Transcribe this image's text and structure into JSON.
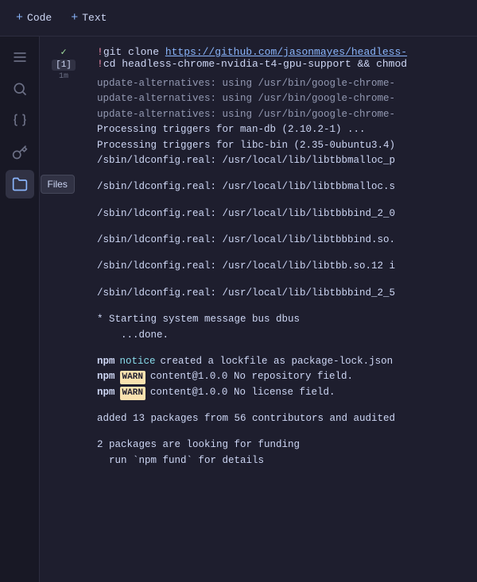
{
  "toolbar": {
    "code_btn_label": "Code",
    "text_btn_label": "Text",
    "plus_symbol": "+"
  },
  "sidebar": {
    "items": [
      {
        "id": "menu",
        "label": "Menu",
        "icon": "menu"
      },
      {
        "id": "search",
        "label": "Search",
        "icon": "search"
      },
      {
        "id": "variables",
        "label": "Variables",
        "icon": "variables"
      },
      {
        "id": "secrets",
        "label": "Secrets",
        "icon": "secrets"
      },
      {
        "id": "files",
        "label": "Files",
        "icon": "files",
        "active": true,
        "tooltip": "Files"
      }
    ]
  },
  "cell": {
    "run_indicator": "✓",
    "number": "[1]",
    "time": "1m",
    "commands": [
      "!git clone https://github.com/jasonmayes/headless-",
      "!cd headless-chrome-nvidia-t4-gpu-support && chmod"
    ],
    "output_lines": [
      "update-alternatives: using /usr/bin/google-chrome-",
      "update-alternatives: using /usr/bin/google-chrome-",
      "update-alternatives: using /usr/bin/google-chrome-",
      "Processing triggers for man-db (2.10.2-1) ...",
      "Processing triggers for libc-bin (2.35-0ubuntu3.4)",
      "/sbin/ldconfig.real: /usr/local/lib/libtbbmalloc_p",
      "",
      "/sbin/ldconfig.real: /usr/local/lib/libtbbmalloc.s",
      "",
      "/sbin/ldconfig.real: /usr/local/lib/libtbbbind_2_0",
      "",
      "/sbin/ldconfig.real: /usr/local/lib/libtbbbind.so.",
      "",
      "/sbin/ldconfig.real: /usr/local/lib/libtbb.so.12 i",
      "",
      "/sbin/ldconfig.real: /usr/local/lib/libtbbbind_2_5",
      "",
      " * Starting system message bus dbus",
      "    ...done.",
      "",
      "added 13 packages from 56 contributors and audited",
      "",
      "2 packages are looking for funding",
      "  run `npm fund` for details"
    ],
    "npm_lines": [
      {
        "type": "notice",
        "npm": "npm",
        "badge_type": "notice",
        "badge_text": "notice",
        "text": "created a lockfile as package-lock.json"
      },
      {
        "type": "warn",
        "npm": "npm",
        "badge_type": "warn",
        "badge_text": "WARN",
        "text": "content@1.0.0 No repository field."
      },
      {
        "type": "warn",
        "npm": "npm",
        "badge_type": "warn",
        "badge_text": "WARN",
        "text": "content@1.0.0 No license field."
      }
    ]
  },
  "colors": {
    "background": "#1e1e2e",
    "sidebar_bg": "#181825",
    "accent_blue": "#89b4fa",
    "green": "#a6e3a1",
    "text_main": "#cdd6f4",
    "text_dim": "#6c7086",
    "warn_yellow": "#f9e2af",
    "notice_cyan": "#89dceb"
  }
}
